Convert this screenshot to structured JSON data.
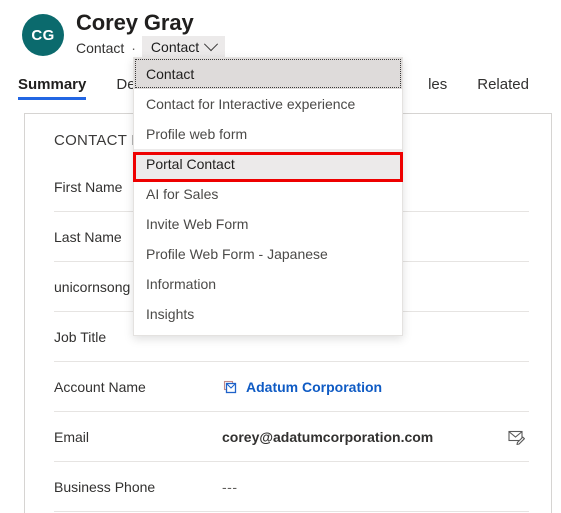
{
  "header": {
    "avatar_initials": "CG",
    "record_name": "Corey Gray",
    "entity_label": "Contact",
    "separator": "·",
    "form_selector_label": "Contact",
    "form_selector_chevron_icon": "chevron-down-icon",
    "avatar_color": "#0b6a6d"
  },
  "tabs": [
    {
      "label": "Summary",
      "selected": true
    },
    {
      "label": "Deta",
      "selected": false
    },
    {
      "label": "les",
      "selected": false
    },
    {
      "label": "Related",
      "selected": false
    }
  ],
  "card": {
    "section_header": "CONTACT INF",
    "fields": [
      {
        "label": "First Name",
        "value": "",
        "style": "plain",
        "action_icon": ""
      },
      {
        "label": "Last Name",
        "value": "",
        "style": "plain",
        "action_icon": ""
      },
      {
        "label": "unicornsong",
        "value": "",
        "style": "plain",
        "action_icon": ""
      },
      {
        "label": "Job Title",
        "value": "",
        "style": "plain",
        "action_icon": ""
      },
      {
        "label": "Account Name",
        "value": "Adatum Corporation",
        "style": "link",
        "action_icon": "",
        "leading_icon": "account-icon"
      },
      {
        "label": "Email",
        "value": "corey@adatumcorporation.com",
        "style": "bold",
        "action_icon": "compose-email-icon"
      },
      {
        "label": "Business Phone",
        "value": "---",
        "style": "muted",
        "action_icon": ""
      }
    ]
  },
  "form_selector_flyout": {
    "items": [
      {
        "label": "Contact",
        "state": "current"
      },
      {
        "label": "Contact for Interactive experience",
        "state": "normal"
      },
      {
        "label": "Profile web form",
        "state": "normal"
      },
      {
        "label": "Portal Contact",
        "state": "highlighted"
      },
      {
        "label": "AI for Sales",
        "state": "normal"
      },
      {
        "label": "Invite Web Form",
        "state": "normal"
      },
      {
        "label": "Profile Web Form - Japanese",
        "state": "normal"
      },
      {
        "label": "Information",
        "state": "normal"
      },
      {
        "label": "Insights",
        "state": "normal"
      }
    ],
    "highlight_color": "#ee0000"
  }
}
